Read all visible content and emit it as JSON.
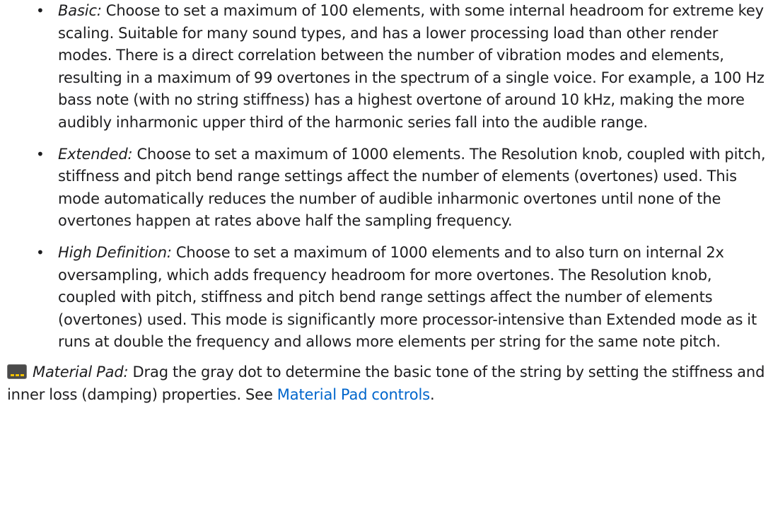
{
  "render_modes": [
    {
      "term": "Basic:",
      "description": " Choose to set a maximum of 100 elements, with some internal headroom for extreme key scaling. Suitable for many sound types, and has a lower processing load than other render modes. There is a direct correlation between the number of vibration modes and elements, resulting in a maximum of 99 overtones in the spectrum of a single voice. For example, a 100 Hz bass note (with no string stiffness) has a highest overtone of around 10 kHz, making the more audibly inharmonic upper third of the harmonic series fall into the audible range."
    },
    {
      "term": "Extended:",
      "description": " Choose to set a maximum of 1000 elements. The Resolution knob, coupled with pitch, stiffness and pitch bend range settings affect the number of elements (overtones) used. This mode automatically reduces the number of audible inharmonic overtones until none of the overtones happen at rates above half the sampling frequency."
    },
    {
      "term": "High Definition:",
      "description": " Choose to set a maximum of 1000 elements and to also turn on internal 2x oversampling, which adds frequency headroom for more overtones. The Resolution knob, coupled with pitch, stiffness and pitch bend range settings affect the number of elements (overtones) used. This mode is significantly more processor-intensive than Extended mode as it runs at double the frequency and allows more elements per string for the same note pitch."
    }
  ],
  "material_pad": {
    "icon": "material-pad-icon",
    "term": "Material Pad:",
    "description": " Drag the gray dot to determine the basic tone of the string by setting the stiffness and inner loss (damping) properties. See ",
    "link_text": "Material Pad controls",
    "trailing": "."
  },
  "bullet_glyph": "•",
  "colors": {
    "text": "#1d1d1f",
    "link": "#0066cc",
    "pad_icon_bg": "#4a4a4a",
    "pad_icon_dot": "#f2c200"
  }
}
